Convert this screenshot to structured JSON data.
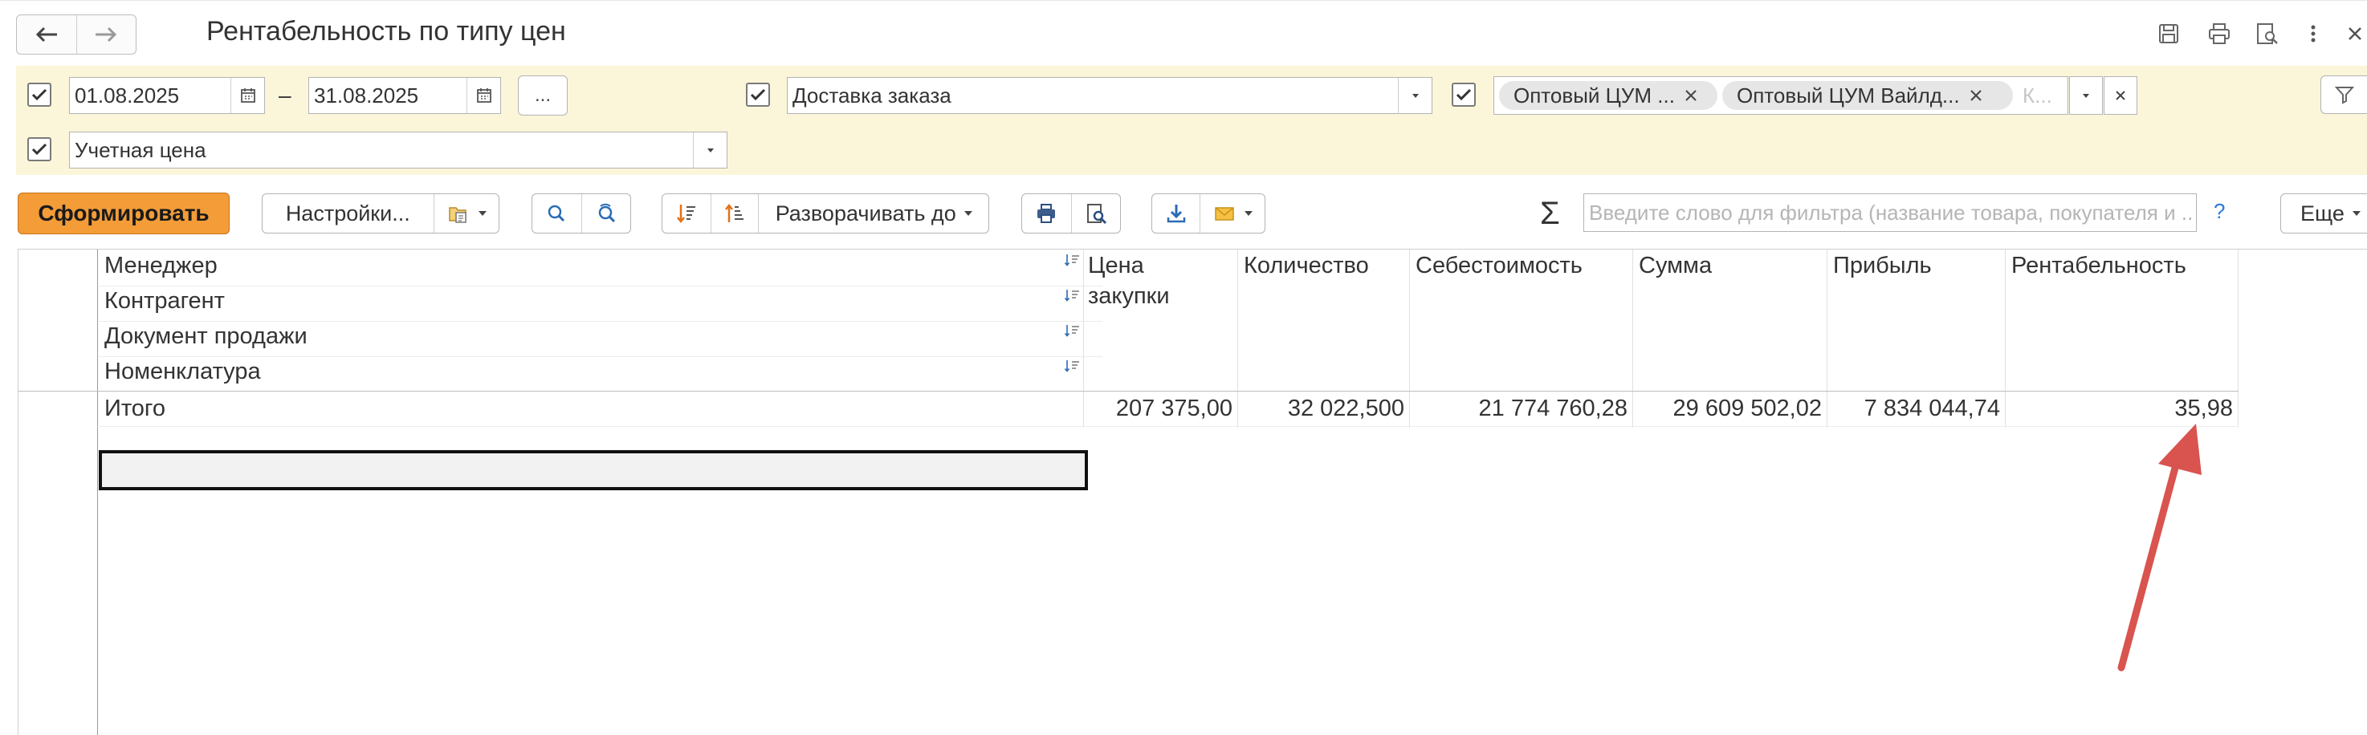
{
  "header": {
    "title": "Рентабельность по типу цен"
  },
  "filters": {
    "period": {
      "from": "01.08.2025",
      "to": "31.08.2025",
      "dash": "–",
      "more_label": "..."
    },
    "delivery": {
      "value": "Доставка заказа"
    },
    "price_types": {
      "tags": [
        "Оптовый ЦУМ ...",
        "Оптовый ЦУМ Вайлд..."
      ],
      "more_hint": "К..."
    },
    "price_kind": {
      "value": "Учетная цена"
    }
  },
  "toolbar": {
    "generate_label": "Сформировать",
    "settings_label": "Настройки...",
    "expand_label": "Разворачивать до",
    "sigma": "Σ",
    "search_placeholder": "Введите слово для фильтра (название товара, покупателя и ...",
    "help": "?",
    "more_label": "Еще"
  },
  "report": {
    "grouping_headers": [
      "Менеджер",
      "Контрагент",
      "Документ продажи",
      "Номенклатура"
    ],
    "columns": [
      {
        "line1": "Цена",
        "line2": "закупки"
      },
      {
        "line1": "Количество",
        "line2": ""
      },
      {
        "line1": "Себестоимость",
        "line2": ""
      },
      {
        "line1": "Сумма",
        "line2": ""
      },
      {
        "line1": "Прибыль",
        "line2": ""
      },
      {
        "line1": "Рентабельность",
        "line2": ""
      }
    ],
    "total_row": {
      "label": "Итого",
      "values": [
        "207 375,00",
        "32 022,500",
        "21 774 760,28",
        "29 609 502,02",
        "7 834 044,74",
        "35,98"
      ]
    }
  },
  "colors": {
    "filter_bg": "#fbf6d9",
    "generate_button": "#f39c38",
    "annotation_arrow": "#d9534f",
    "help_link": "#2a7ad6"
  },
  "icons": {
    "nav": [
      "arrow-left-icon",
      "arrow-right-icon"
    ],
    "header_actions": [
      "save-icon",
      "print-icon",
      "preview-icon",
      "more-vertical-icon",
      "close-icon"
    ],
    "toolbar": [
      "search-icon",
      "search-next-icon",
      "sort-desc-icon",
      "sort-asc-icon",
      "print-icon",
      "print-preview-icon",
      "download-icon",
      "mail-icon",
      "filter-icon"
    ]
  }
}
